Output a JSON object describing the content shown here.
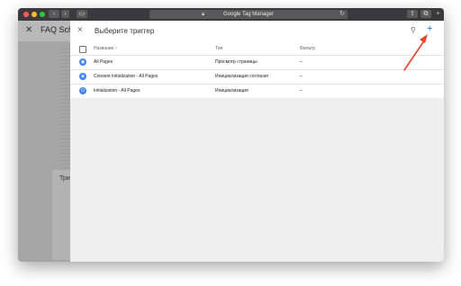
{
  "browser": {
    "url": "Google Tag Manager",
    "lock_icon": "lock-icon",
    "reload_icon": "reload-icon"
  },
  "background": {
    "title": "FAQ Sche",
    "card_label": "Триг"
  },
  "drawer": {
    "title": "Выберите триггер",
    "close": "×",
    "search": "⚲",
    "add": "+",
    "columns": {
      "name": "Название",
      "sort": "↑",
      "type": "Тип",
      "filter": "Фильтр"
    },
    "rows": [
      {
        "name": "All Pages",
        "type": "Просмотр страницы",
        "filter": "–",
        "icon": "eye-icon"
      },
      {
        "name": "Consent Initialization - All Pages",
        "type": "Инициализация согласия",
        "filter": "–",
        "icon": "shield-icon"
      },
      {
        "name": "Initialization - All Pages",
        "type": "Инициализация",
        "filter": "–",
        "icon": "power-icon"
      }
    ]
  },
  "colors": {
    "accent": "#1a73e8",
    "trigger_icon": "#4285f4",
    "annotation": "#e8452c"
  }
}
